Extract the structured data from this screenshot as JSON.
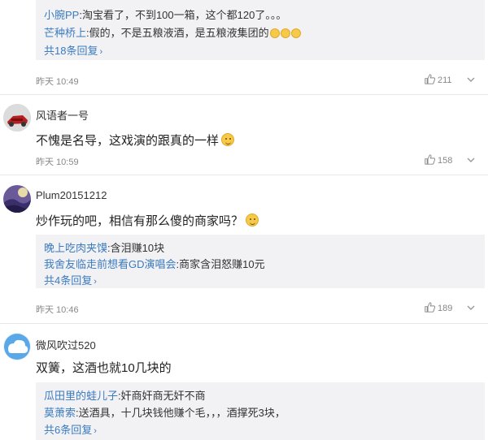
{
  "comments": [
    {
      "replies": [
        {
          "name": "小腕PP",
          "text": ":淘宝看了，不到100一箱，这个都120了。。。"
        },
        {
          "name": "芒种桥上",
          "text": ":假的，不是五粮液酒，是五粮液集团的"
        }
      ],
      "more_replies": "共18条回复",
      "time": "昨天 10:49",
      "likes": "211"
    },
    {
      "username": "风语者一号",
      "content": "不愧是名导，这戏演的跟真的一样",
      "time": "昨天 10:59",
      "likes": "158"
    },
    {
      "username": "Plum20151212",
      "content": "炒作玩的吧，相信有那么傻的商家吗？",
      "replies": [
        {
          "name": "晚上吃肉夹馍",
          "text": ":含泪赚10块"
        },
        {
          "name": "我舍友临走前想看GD演唱会",
          "text": ":商家含泪怒赚10元"
        }
      ],
      "more_replies": "共4条回复",
      "time": "昨天 10:46",
      "likes": "189"
    },
    {
      "username": "微风吹过520",
      "content": "双簧，这酒也就10几块的",
      "replies": [
        {
          "name": "瓜田里的蛙儿子",
          "text": ":奸商奸商无奸不商"
        },
        {
          "name": "莫萧索",
          "text": ":送酒具，十几块钱他赚个毛，，，酒撑死3块，"
        }
      ],
      "more_replies": "共6条回复"
    }
  ],
  "icons": {
    "like": "thumbs-up-icon",
    "dropdown": "chevron-down-icon"
  },
  "colors": {
    "link": "#3b7bbf",
    "reply_bg": "#f2f2f5",
    "meta": "#888888"
  }
}
